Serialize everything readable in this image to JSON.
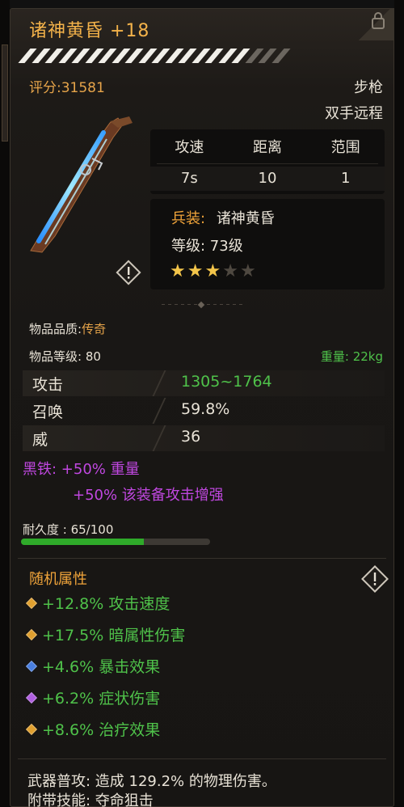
{
  "item": {
    "title": "诸神黄昏 +18",
    "score": "评分:31581",
    "weapon_type": "步枪",
    "weapon_class": "双手远程",
    "title_color": "#f3b24a"
  },
  "stats_table": {
    "headers": [
      "攻速",
      "距离",
      "范围"
    ],
    "values": [
      "7s",
      "10",
      "1"
    ]
  },
  "info": {
    "set_label": "兵装:",
    "set_name": "诸神黄昏",
    "level_text": "等级: 73级",
    "stars_total": 5,
    "stars_filled": 3
  },
  "details": {
    "quality_label": "物品品质:",
    "quality_value": "传奇",
    "item_level": "物品等级: 80",
    "weight": "重量: 22kg"
  },
  "attributes": [
    {
      "name": "攻击",
      "value": "1305~1764",
      "color": "#4fc24a"
    },
    {
      "name": "召唤",
      "value": "59.8%",
      "color": "#e8e2d6"
    },
    {
      "name": "威",
      "value": "36",
      "color": "#e8e2d6"
    }
  ],
  "iron": {
    "line1": "黑铁: +50% 重量",
    "line2": "+50% 该装备攻击增强",
    "color": "#c047e0"
  },
  "durability": {
    "label": "耐久度 : 65/100",
    "current": 65,
    "max": 100
  },
  "random_attrs": {
    "title": "随机属性",
    "items": [
      {
        "text": "+12.8% 攻击速度",
        "gem_color": "#e0a030"
      },
      {
        "text": "+17.5% 暗属性伤害",
        "gem_color": "#e0a030"
      },
      {
        "text": "+4.6% 暴击效果",
        "gem_color": "#4a7fe0"
      },
      {
        "text": "+6.2% 症状伤害",
        "gem_color": "#b060e0"
      },
      {
        "text": "+8.6% 治疗效果",
        "gem_color": "#e0a030"
      }
    ]
  },
  "footer": {
    "line1": "武器普攻: 造成 129.2% 的物理伤害。",
    "line2": "附带技能: 夺命狙击"
  },
  "icons": [
    "lock-icon",
    "warning-icon",
    "star-icon",
    "gem-icon"
  ]
}
